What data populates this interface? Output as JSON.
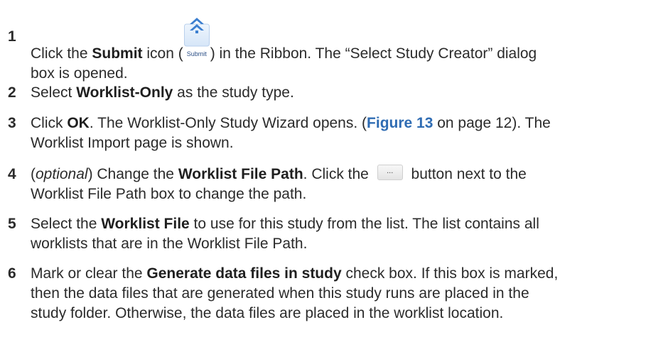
{
  "steps": [
    {
      "num": "1",
      "p1": "Click the ",
      "b1": "Submit",
      "p2": " icon (",
      "icon_label": "Submit",
      "p3": ") in the Ribbon. The “Select Study Creator” dialog",
      "line2": "box is opened."
    },
    {
      "num": "2",
      "p1": "Select ",
      "b1": "Worklist-Only",
      "p2": " as the study type."
    },
    {
      "num": "3",
      "p1": "Click ",
      "b1": "OK",
      "p2": ". The Worklist-Only Study Wizard opens. (",
      "fig": "Figure 13",
      "p3": " on page 12). The",
      "line2": "Worklist Import page is shown."
    },
    {
      "num": "4",
      "p0": "(",
      "em": "optional",
      "p1": ") Change the ",
      "b1": "Worklist File Path",
      "p2": ". Click the ",
      "button_label": "...",
      "p3": " button next to the",
      "line2": "Worklist File Path box to change the path."
    },
    {
      "num": "5",
      "p1": "Select the ",
      "b1": "Worklist File",
      "p2": " to use for this study from the list. The list contains all",
      "line2": "worklists that are in the Worklist File Path."
    },
    {
      "num": "6",
      "p1": "Mark or clear the ",
      "b1": "Generate data files in study",
      "p2": " check box. If this box is marked,",
      "line2": "then the data files that are generated when this study runs are placed in the",
      "line3": "study folder. Otherwise, the data files are placed in the worklist location."
    }
  ],
  "icons": {
    "submit": "submit-double-chevron-up-icon",
    "browse": "ellipsis-button-icon"
  },
  "colors": {
    "link": "#2f6cb3",
    "icon_blue": "#3c7fd0"
  }
}
